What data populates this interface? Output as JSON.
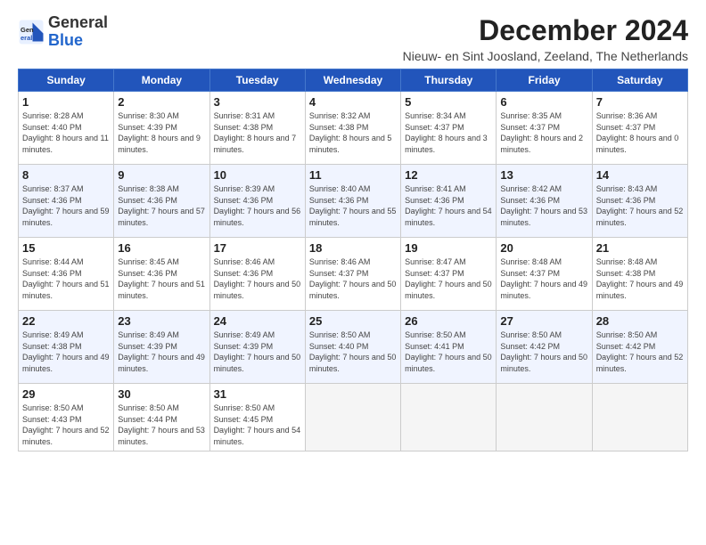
{
  "logo": {
    "general": "General",
    "blue": "Blue"
  },
  "header": {
    "title": "December 2024",
    "subtitle": "Nieuw- en Sint Joosland, Zeeland, The Netherlands"
  },
  "weekdays": [
    "Sunday",
    "Monday",
    "Tuesday",
    "Wednesday",
    "Thursday",
    "Friday",
    "Saturday"
  ],
  "weeks": [
    [
      {
        "day": "1",
        "sunrise": "Sunrise: 8:28 AM",
        "sunset": "Sunset: 4:40 PM",
        "daylight": "Daylight: 8 hours and 11 minutes."
      },
      {
        "day": "2",
        "sunrise": "Sunrise: 8:30 AM",
        "sunset": "Sunset: 4:39 PM",
        "daylight": "Daylight: 8 hours and 9 minutes."
      },
      {
        "day": "3",
        "sunrise": "Sunrise: 8:31 AM",
        "sunset": "Sunset: 4:38 PM",
        "daylight": "Daylight: 8 hours and 7 minutes."
      },
      {
        "day": "4",
        "sunrise": "Sunrise: 8:32 AM",
        "sunset": "Sunset: 4:38 PM",
        "daylight": "Daylight: 8 hours and 5 minutes."
      },
      {
        "day": "5",
        "sunrise": "Sunrise: 8:34 AM",
        "sunset": "Sunset: 4:37 PM",
        "daylight": "Daylight: 8 hours and 3 minutes."
      },
      {
        "day": "6",
        "sunrise": "Sunrise: 8:35 AM",
        "sunset": "Sunset: 4:37 PM",
        "daylight": "Daylight: 8 hours and 2 minutes."
      },
      {
        "day": "7",
        "sunrise": "Sunrise: 8:36 AM",
        "sunset": "Sunset: 4:37 PM",
        "daylight": "Daylight: 8 hours and 0 minutes."
      }
    ],
    [
      {
        "day": "8",
        "sunrise": "Sunrise: 8:37 AM",
        "sunset": "Sunset: 4:36 PM",
        "daylight": "Daylight: 7 hours and 59 minutes."
      },
      {
        "day": "9",
        "sunrise": "Sunrise: 8:38 AM",
        "sunset": "Sunset: 4:36 PM",
        "daylight": "Daylight: 7 hours and 57 minutes."
      },
      {
        "day": "10",
        "sunrise": "Sunrise: 8:39 AM",
        "sunset": "Sunset: 4:36 PM",
        "daylight": "Daylight: 7 hours and 56 minutes."
      },
      {
        "day": "11",
        "sunrise": "Sunrise: 8:40 AM",
        "sunset": "Sunset: 4:36 PM",
        "daylight": "Daylight: 7 hours and 55 minutes."
      },
      {
        "day": "12",
        "sunrise": "Sunrise: 8:41 AM",
        "sunset": "Sunset: 4:36 PM",
        "daylight": "Daylight: 7 hours and 54 minutes."
      },
      {
        "day": "13",
        "sunrise": "Sunrise: 8:42 AM",
        "sunset": "Sunset: 4:36 PM",
        "daylight": "Daylight: 7 hours and 53 minutes."
      },
      {
        "day": "14",
        "sunrise": "Sunrise: 8:43 AM",
        "sunset": "Sunset: 4:36 PM",
        "daylight": "Daylight: 7 hours and 52 minutes."
      }
    ],
    [
      {
        "day": "15",
        "sunrise": "Sunrise: 8:44 AM",
        "sunset": "Sunset: 4:36 PM",
        "daylight": "Daylight: 7 hours and 51 minutes."
      },
      {
        "day": "16",
        "sunrise": "Sunrise: 8:45 AM",
        "sunset": "Sunset: 4:36 PM",
        "daylight": "Daylight: 7 hours and 51 minutes."
      },
      {
        "day": "17",
        "sunrise": "Sunrise: 8:46 AM",
        "sunset": "Sunset: 4:36 PM",
        "daylight": "Daylight: 7 hours and 50 minutes."
      },
      {
        "day": "18",
        "sunrise": "Sunrise: 8:46 AM",
        "sunset": "Sunset: 4:37 PM",
        "daylight": "Daylight: 7 hours and 50 minutes."
      },
      {
        "day": "19",
        "sunrise": "Sunrise: 8:47 AM",
        "sunset": "Sunset: 4:37 PM",
        "daylight": "Daylight: 7 hours and 50 minutes."
      },
      {
        "day": "20",
        "sunrise": "Sunrise: 8:48 AM",
        "sunset": "Sunset: 4:37 PM",
        "daylight": "Daylight: 7 hours and 49 minutes."
      },
      {
        "day": "21",
        "sunrise": "Sunrise: 8:48 AM",
        "sunset": "Sunset: 4:38 PM",
        "daylight": "Daylight: 7 hours and 49 minutes."
      }
    ],
    [
      {
        "day": "22",
        "sunrise": "Sunrise: 8:49 AM",
        "sunset": "Sunset: 4:38 PM",
        "daylight": "Daylight: 7 hours and 49 minutes."
      },
      {
        "day": "23",
        "sunrise": "Sunrise: 8:49 AM",
        "sunset": "Sunset: 4:39 PM",
        "daylight": "Daylight: 7 hours and 49 minutes."
      },
      {
        "day": "24",
        "sunrise": "Sunrise: 8:49 AM",
        "sunset": "Sunset: 4:39 PM",
        "daylight": "Daylight: 7 hours and 50 minutes."
      },
      {
        "day": "25",
        "sunrise": "Sunrise: 8:50 AM",
        "sunset": "Sunset: 4:40 PM",
        "daylight": "Daylight: 7 hours and 50 minutes."
      },
      {
        "day": "26",
        "sunrise": "Sunrise: 8:50 AM",
        "sunset": "Sunset: 4:41 PM",
        "daylight": "Daylight: 7 hours and 50 minutes."
      },
      {
        "day": "27",
        "sunrise": "Sunrise: 8:50 AM",
        "sunset": "Sunset: 4:42 PM",
        "daylight": "Daylight: 7 hours and 50 minutes."
      },
      {
        "day": "28",
        "sunrise": "Sunrise: 8:50 AM",
        "sunset": "Sunset: 4:42 PM",
        "daylight": "Daylight: 7 hours and 52 minutes."
      }
    ],
    [
      {
        "day": "29",
        "sunrise": "Sunrise: 8:50 AM",
        "sunset": "Sunset: 4:43 PM",
        "daylight": "Daylight: 7 hours and 52 minutes."
      },
      {
        "day": "30",
        "sunrise": "Sunrise: 8:50 AM",
        "sunset": "Sunset: 4:44 PM",
        "daylight": "Daylight: 7 hours and 53 minutes."
      },
      {
        "day": "31",
        "sunrise": "Sunrise: 8:50 AM",
        "sunset": "Sunset: 4:45 PM",
        "daylight": "Daylight: 7 hours and 54 minutes."
      },
      null,
      null,
      null,
      null
    ]
  ]
}
